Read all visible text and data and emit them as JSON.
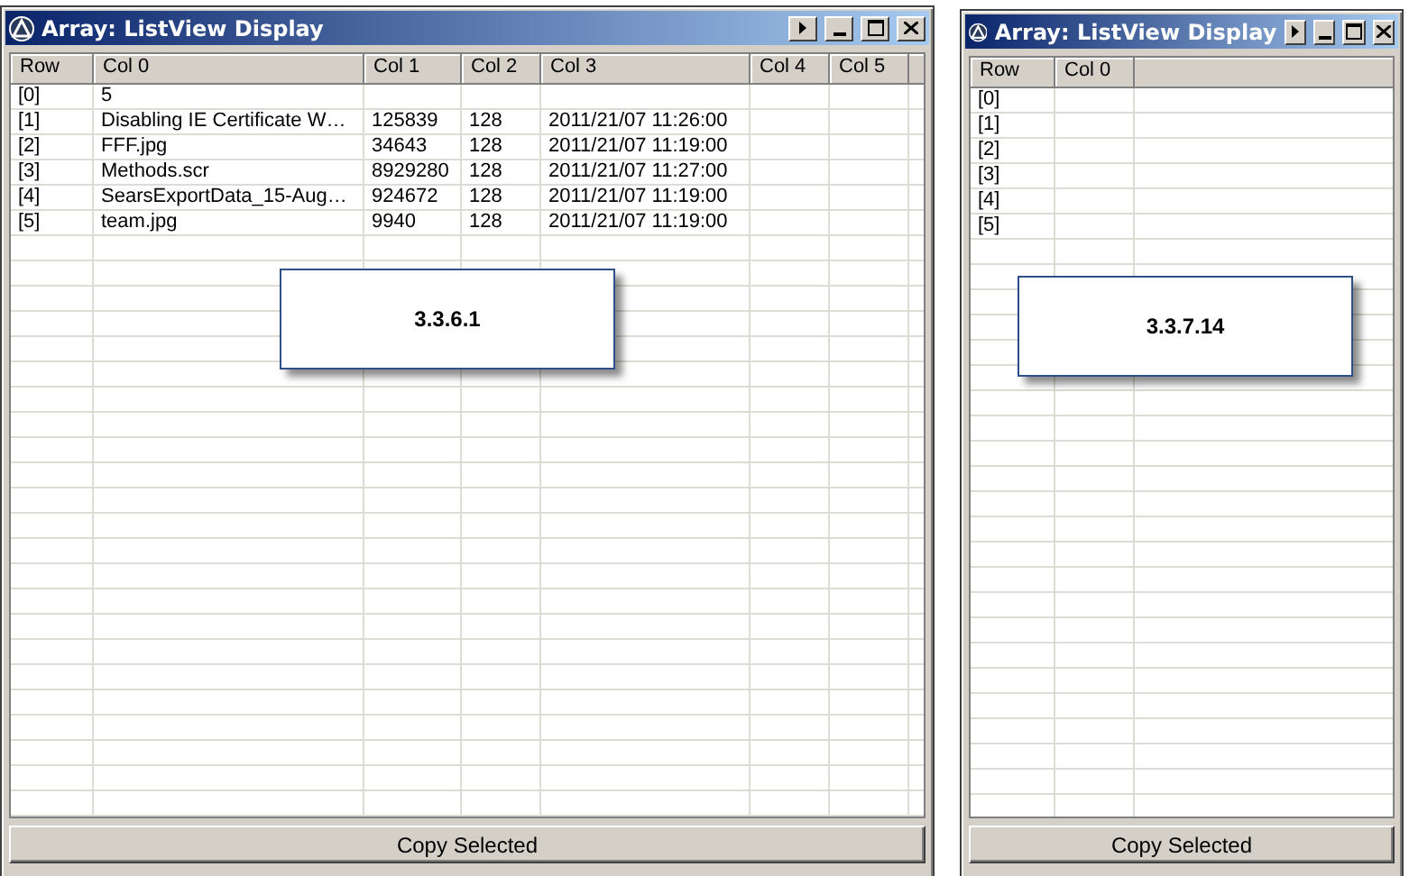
{
  "windows": [
    {
      "title": "Array: ListView Display",
      "columns": [
        "Row",
        "Col 0",
        "Col 1",
        "Col 2",
        "Col 3",
        "Col 4",
        "Col 5"
      ],
      "rows": [
        [
          "[0]",
          "5",
          "",
          "",
          "",
          "",
          ""
        ],
        [
          "[1]",
          "Disabling IE Certificate W…",
          "125839",
          "128",
          "2011/21/07 11:26:00",
          "",
          ""
        ],
        [
          "[2]",
          "FFF.jpg",
          "34643",
          "128",
          "2011/21/07 11:19:00",
          "",
          ""
        ],
        [
          "[3]",
          "Methods.scr",
          "8929280",
          "128",
          "2011/21/07 11:27:00",
          "",
          ""
        ],
        [
          "[4]",
          "SearsExportData_15-Aug…",
          "924672",
          "128",
          "2011/21/07 11:19:00",
          "",
          ""
        ],
        [
          "[5]",
          "team.jpg",
          "9940",
          "128",
          "2011/21/07 11:19:00",
          "",
          ""
        ]
      ],
      "callout": "3.3.6.1",
      "button": "Copy Selected"
    },
    {
      "title": "Array: ListView Display",
      "columns": [
        "Row",
        "Col 0"
      ],
      "rows": [
        [
          "[0]",
          ""
        ],
        [
          "[1]",
          ""
        ],
        [
          "[2]",
          ""
        ],
        [
          "[3]",
          ""
        ],
        [
          "[4]",
          ""
        ],
        [
          "[5]",
          ""
        ]
      ],
      "callout": "3.3.7.14",
      "button": "Copy Selected"
    }
  ]
}
